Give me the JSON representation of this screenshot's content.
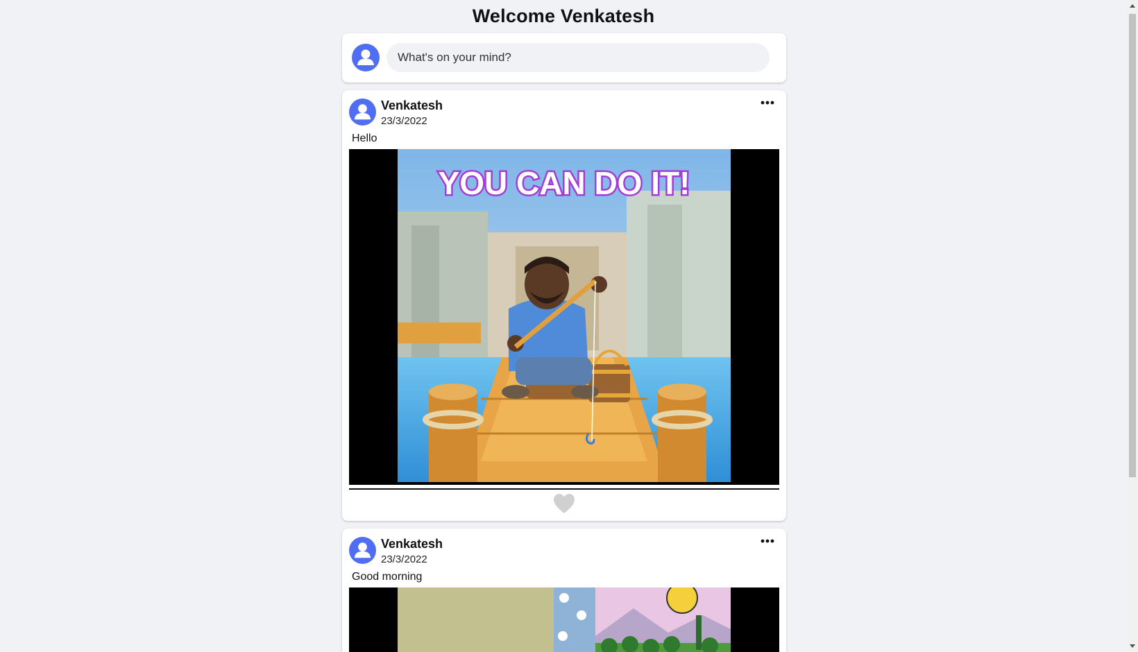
{
  "header": {
    "title": "Welcome Venkatesh"
  },
  "composer": {
    "placeholder": "What's on your mind?"
  },
  "posts": [
    {
      "author": "Venkatesh",
      "date": "23/3/2022",
      "text": "Hello",
      "image_caption": "YOU CAN DO IT!",
      "liked": false
    },
    {
      "author": "Venkatesh",
      "date": "23/3/2022",
      "text": "Good morning"
    }
  ],
  "icons": {
    "avatar": "user-avatar-icon",
    "more": "more-options-icon",
    "like": "heart-icon"
  },
  "colors": {
    "background": "#f0f2f5",
    "avatar": "#4f6ef2",
    "like_inactive": "#d0d0d0",
    "caption_fill": "#ffffff",
    "caption_stroke": "#a53bd6"
  }
}
